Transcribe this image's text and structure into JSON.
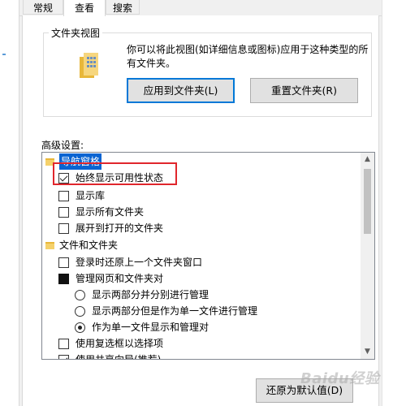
{
  "tabs": [
    {
      "label": "常规"
    },
    {
      "label": "查看"
    },
    {
      "label": "搜索"
    }
  ],
  "folder_views": {
    "title": "文件夹视图",
    "description": "你可以将此视图(如详细信息或图标)应用于这种类型的所有文件夹。",
    "apply_button": "应用到文件夹(L)",
    "reset_button": "重置文件夹(R)"
  },
  "advanced": {
    "label": "高级设置:",
    "items": [
      {
        "label": "导航窗格",
        "kind": "folder",
        "selected": true
      },
      {
        "label": "始终显示可用性状态",
        "kind": "checkbox",
        "checked": true
      },
      {
        "label": "显示库",
        "kind": "checkbox",
        "checked": false
      },
      {
        "label": "显示所有文件夹",
        "kind": "checkbox",
        "checked": false
      },
      {
        "label": "展开到打开的文件夹",
        "kind": "checkbox",
        "checked": false
      },
      {
        "label": "文件和文件夹",
        "kind": "folder",
        "selected": false
      },
      {
        "label": "登录时还原上一个文件夹窗口",
        "kind": "checkbox",
        "checked": false
      },
      {
        "label": "管理网页和文件夹对",
        "kind": "indeterminate"
      },
      {
        "label": "显示两部分并分别进行管理",
        "kind": "radio",
        "checked": false
      },
      {
        "label": "显示两部分但是作为单一文件进行管理",
        "kind": "radio",
        "checked": false
      },
      {
        "label": "作为单一文件显示和管理对",
        "kind": "radio",
        "checked": true
      },
      {
        "label": "使用复选框以选择项",
        "kind": "checkbox",
        "checked": false
      },
      {
        "label": "使用共享向导(推荐)",
        "kind": "checkbox",
        "checked": true
      }
    ]
  },
  "restore_button": "还原为默认值(D)",
  "watermark": "Baidu经验",
  "colors": {
    "selection": "#0a64d2",
    "annotation": "#e0262c",
    "focus_border": "#0078d7"
  }
}
